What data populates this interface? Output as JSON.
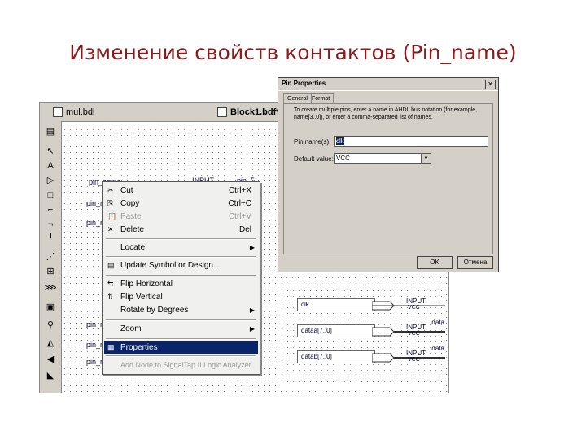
{
  "slide": {
    "title": "Изменение свойств контактов (Pin_name)"
  },
  "window": {
    "tabs": [
      {
        "label": "mul.bdl"
      },
      {
        "label": "Block1.bdf*"
      }
    ],
    "tools": [
      "▤",
      "↖",
      "A",
      "▷",
      "□",
      "⌐",
      "¬",
      "╹",
      "⋰",
      "⊞",
      "⋙",
      "▣",
      "⚲",
      "◭",
      "◀",
      "◣"
    ],
    "pin_labels": [
      "pin_name",
      "pin_na",
      "pin_na",
      "pin_na",
      "pin_na",
      "pin_na"
    ],
    "canvas_texts": [
      "INPUT",
      "pin_5"
    ]
  },
  "context_menu": {
    "items": [
      {
        "icon": "cut-icon",
        "glyph": "✂",
        "label": "Cut",
        "shortcut": "Ctrl+X",
        "disabled": false
      },
      {
        "icon": "copy-icon",
        "glyph": "⎘",
        "label": "Copy",
        "shortcut": "Ctrl+C",
        "disabled": false
      },
      {
        "icon": "paste-icon",
        "glyph": "📋",
        "label": "Paste",
        "shortcut": "Ctrl+V",
        "disabled": true
      },
      {
        "icon": "delete-icon",
        "glyph": "✕",
        "label": "Delete",
        "shortcut": "Del",
        "disabled": false
      },
      {
        "label": "Locate",
        "submenu": true
      },
      {
        "icon": "update-icon",
        "glyph": "▤",
        "label": "Update Symbol or Design..."
      },
      {
        "icon": "flip-h-icon",
        "glyph": "⇆",
        "label": "Flip Horizontal"
      },
      {
        "icon": "flip-v-icon",
        "glyph": "⇅",
        "label": "Flip Vertical"
      },
      {
        "label": "Rotate by Degrees",
        "submenu": true
      },
      {
        "label": "Zoom",
        "submenu": true
      },
      {
        "icon": "properties-icon",
        "glyph": "▦",
        "label": "Properties",
        "selected": true
      },
      {
        "label": "Add Node to SignalTap II Logic Analyzer",
        "disabled": true
      }
    ]
  },
  "dialog": {
    "title": "Pin Properties",
    "tabs": [
      "General",
      "Format"
    ],
    "description": "To create multiple pins, enter a name in AHDL bus notation (for example, name[3..0]), or enter a comma-separated list of names.",
    "pin_name_label": "Pin name(s):",
    "pin_name_value": "clk",
    "default_value_label": "Default value:",
    "default_value": "VCC",
    "ok_label": "OK",
    "cancel_label": "Отмена"
  },
  "symbols": {
    "pins": [
      {
        "name": "clk",
        "type": "INPUT",
        "vcc": "VCC",
        "net": ""
      },
      {
        "name": "dataa[7..0]",
        "type": "INPUT",
        "vcc": "VCC",
        "net": "data"
      },
      {
        "name": "datab[7..0]",
        "type": "INPUT",
        "vcc": "VCC",
        "net": "data"
      }
    ]
  }
}
